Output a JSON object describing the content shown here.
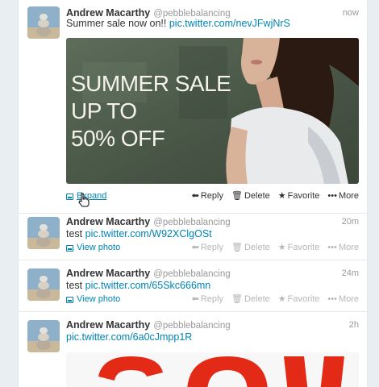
{
  "colors": {
    "link": "#0084b4",
    "muted": "#999999",
    "text": "#333333",
    "promo_red": "#e32a16"
  },
  "tweets": [
    {
      "name": "Andrew Macarthy",
      "username": "@pebblebalancing",
      "time": "now",
      "text": "Summer sale now on!!",
      "link": "pic.twitter.com/nevJFwjNrS",
      "image_text": [
        "SUMMER SALE",
        "UP TO",
        "50% OFF"
      ],
      "media_action": "Expand",
      "actions": {
        "reply": "Reply",
        "delete": "Delete",
        "favorite": "Favorite",
        "more": "More"
      }
    },
    {
      "name": "Andrew Macarthy",
      "username": "@pebblebalancing",
      "time": "20m",
      "text": "test",
      "link": "pic.twitter.com/W92XClgOSt",
      "media_action": "View photo",
      "actions": {
        "reply": "Reply",
        "delete": "Delete",
        "favorite": "Favorite",
        "more": "More"
      }
    },
    {
      "name": "Andrew Macarthy",
      "username": "@pebblebalancing",
      "time": "24m",
      "text": "test",
      "link": "pic.twitter.com/65Skc666mn",
      "media_action": "View photo",
      "actions": {
        "reply": "Reply",
        "delete": "Delete",
        "favorite": "Favorite",
        "more": "More"
      }
    },
    {
      "name": "Andrew Macarthy",
      "username": "@pebblebalancing",
      "time": "2h",
      "link": "pic.twitter.com/6a0cJmpp1R"
    }
  ]
}
